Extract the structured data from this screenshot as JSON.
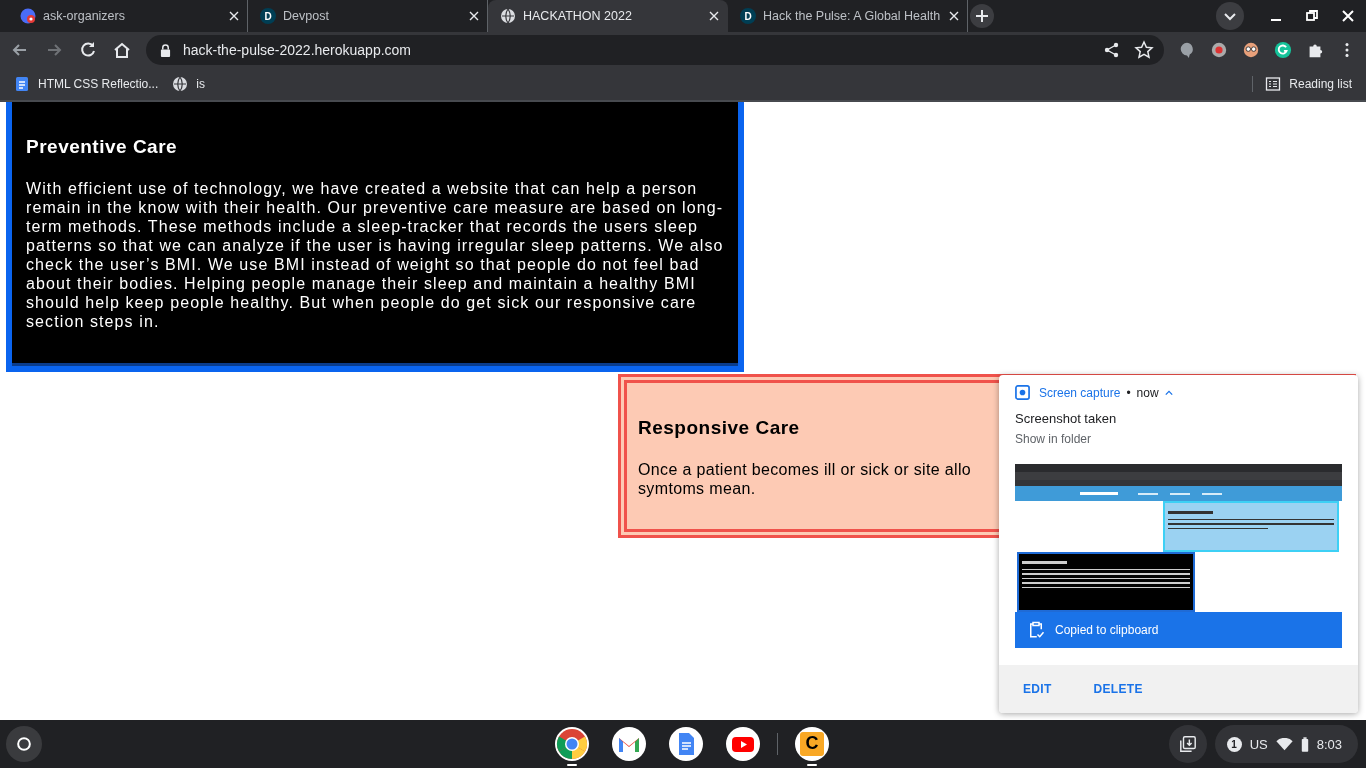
{
  "browser": {
    "tabs": [
      {
        "title": "ask-organizers",
        "selected": false,
        "favicon": {
          "kind": "avatar"
        }
      },
      {
        "title": "Devpost",
        "selected": false,
        "favicon": {
          "kind": "letter",
          "letter": "D"
        }
      },
      {
        "title": "HACKATHON 2022",
        "selected": true,
        "favicon": {
          "kind": "globe"
        }
      },
      {
        "title": "Hack the Pulse: A Global Health",
        "selected": false,
        "favicon": {
          "kind": "letter",
          "letter": "D"
        }
      }
    ],
    "url": "hack-the-pulse-2022.herokuapp.com",
    "bookmarks": [
      {
        "label": "HTML CSS Reflectio...",
        "kind": "doc"
      },
      {
        "label": "is",
        "kind": "globe"
      }
    ],
    "reading_list": "Reading list"
  },
  "page": {
    "preventive": {
      "heading": "Preventive Care",
      "body": "With efficient use of technology, we have created a website that can help a person remain in the know with their health. Our preventive care measure are based on long-term methods. These methods include a sleep-tracker that records the users sleep patterns so that we can analyze if the user is having irregular sleep patterns. We also check the user’s BMI. We use BMI instead of weight so that people do not feel bad about their bodies. Helping people manage their sleep and maintain a healthy BMI should help keep people healthy. But when people do get sick our responsive care section steps in."
    },
    "responsive": {
      "heading": "Responsive Care",
      "lines": [
        "Once a patient becomes ill or sick or site allo",
        "symtoms mean."
      ]
    }
  },
  "notification": {
    "app": "Screen capture",
    "dot": "•",
    "time": "now",
    "expanded": true,
    "title": "Screenshot taken",
    "action": "Show in folder",
    "banner": "Copied to clipboard",
    "buttons": [
      "EDIT",
      "DELETE"
    ]
  },
  "taskbar": {
    "apps": [
      {
        "kind": "chrome",
        "running": true
      },
      {
        "kind": "gmail",
        "running": false
      },
      {
        "kind": "docs",
        "running": false
      },
      {
        "kind": "youtube",
        "running": false
      },
      {
        "kind": "letter",
        "letter": "C",
        "running": true
      }
    ],
    "tray": {
      "badge": "1",
      "ime": "US",
      "time": "8:03"
    }
  }
}
